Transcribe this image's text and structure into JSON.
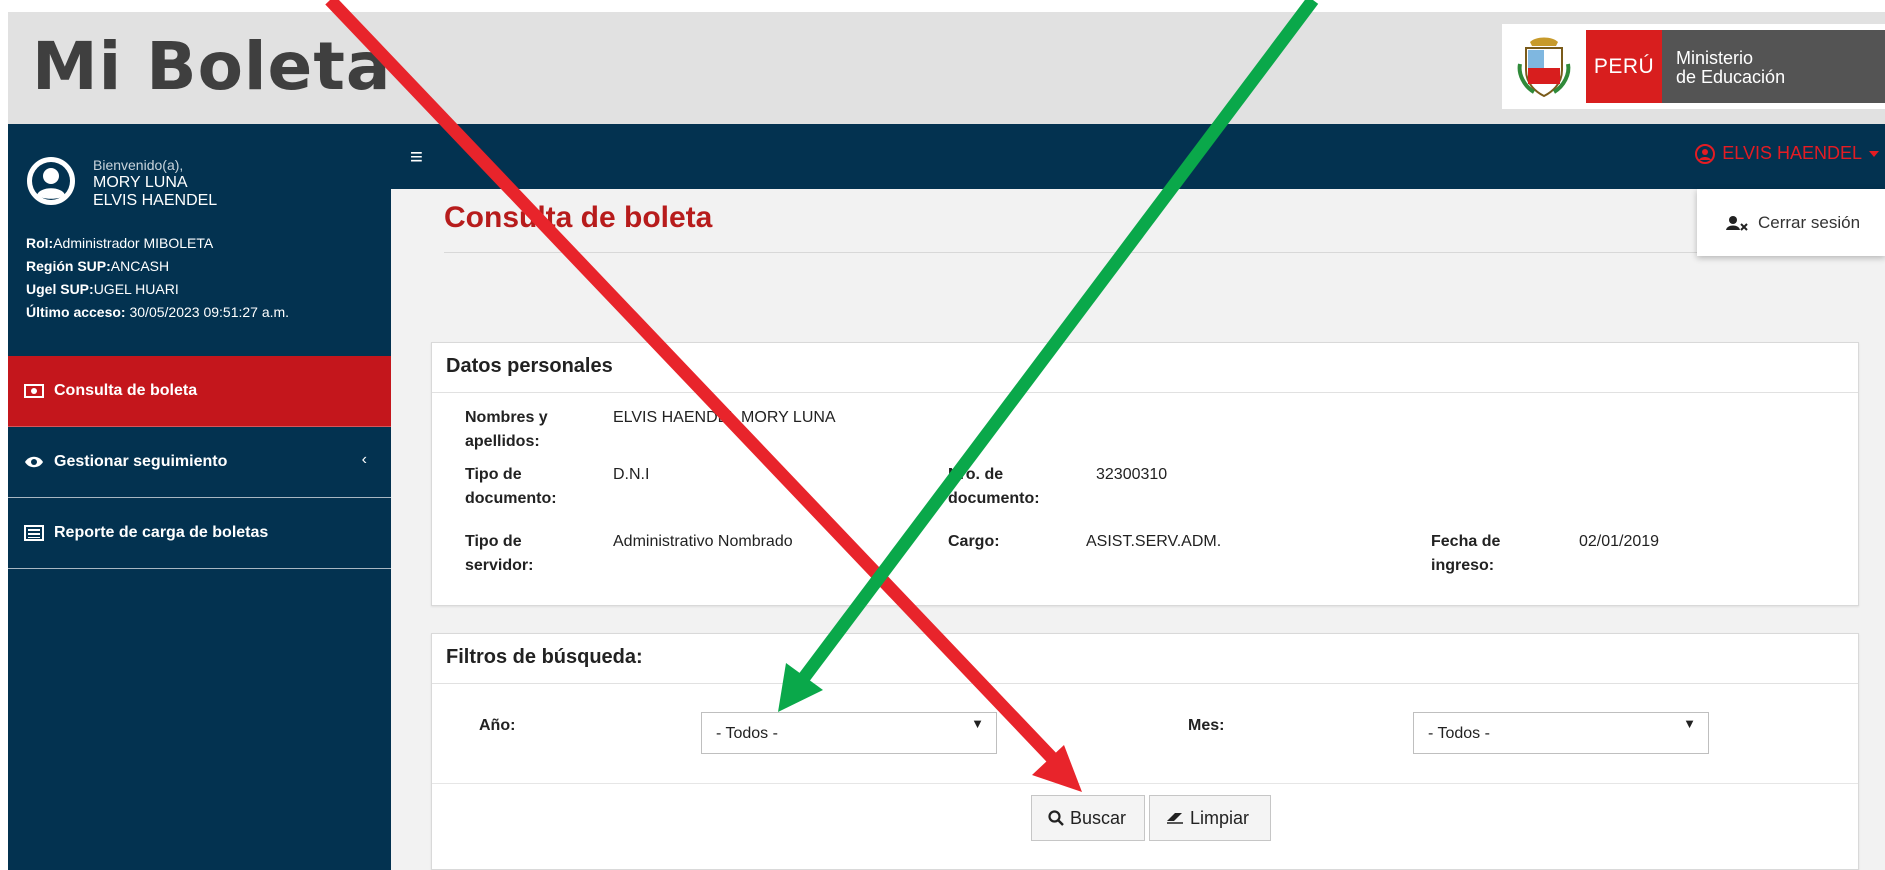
{
  "header": {
    "app_title": "Mi Boleta",
    "peru_label": "PERÚ",
    "ministry_line1": "Ministerio",
    "ministry_line2": "de Educación"
  },
  "sidebar": {
    "welcome": "Bienvenido(a),",
    "user_line1": "MORY LUNA",
    "user_line2": "ELVIS HAENDEL",
    "info": [
      {
        "label": "Rol:",
        "value": "Administrador MIBOLETA"
      },
      {
        "label": "Región SUP:",
        "value": "ANCASH"
      },
      {
        "label": "Ugel SUP:",
        "value": "UGEL HUARI"
      },
      {
        "label": "Último acceso:",
        "value": " 30/05/2023 09:51:27 a.m."
      }
    ],
    "items": [
      {
        "label": "Consulta de boleta",
        "icon": "money-icon",
        "active": true
      },
      {
        "label": "Gestionar seguimiento",
        "icon": "eye-icon",
        "active": false
      },
      {
        "label": "Reporte de carga de boletas",
        "icon": "list-icon",
        "active": false
      }
    ],
    "submenu_indicator": "‹"
  },
  "navbar": {
    "hamburger": "≡",
    "user_name": "ELVIS HAENDEL"
  },
  "dropdown": {
    "logout_label": "Cerrar sesión"
  },
  "main": {
    "page_title": "Consulta de boleta",
    "personal": {
      "title": "Datos personales",
      "names_label_1": "Nombres y",
      "names_label_2": "apellidos:",
      "names_value": "ELVIS HAENDEL MORY LUNA",
      "doc_type_label_1": "Tipo de",
      "doc_type_label_2": "documento:",
      "doc_type_value": "D.N.I",
      "doc_num_label_1": "Nro. de",
      "doc_num_label_2": "documento:",
      "doc_num_value": "32300310",
      "server_type_label_1": "Tipo de",
      "server_type_label_2": "servidor:",
      "server_type_value": "Administrativo Nombrado",
      "cargo_label": "Cargo:",
      "cargo_value": "ASIST.SERV.ADM.",
      "ingreso_label_1": "Fecha de",
      "ingreso_label_2": "ingreso:",
      "ingreso_value": "02/01/2019"
    },
    "filters": {
      "title": "Filtros de búsqueda:",
      "year_label": "Año:",
      "year_value": "- Todos -",
      "month_label": "Mes:",
      "month_value": "- Todos -",
      "search_label": "Buscar",
      "clear_label": "Limpiar"
    }
  },
  "colors": {
    "header_bg": "#e1e1e1",
    "navy": "#033250",
    "active_red": "#c4161c",
    "title_red": "#b71c1c",
    "arrow_red": "#e8242b",
    "arrow_green": "#0aa84a"
  }
}
